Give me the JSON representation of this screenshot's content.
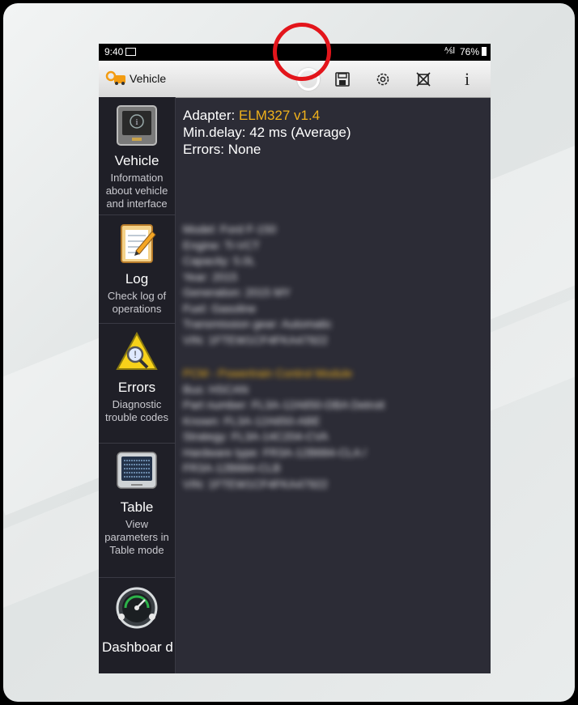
{
  "status_bar": {
    "time": "9:40",
    "signal": "⅍l",
    "battery": "76%"
  },
  "toolbar": {
    "title": "Vehicle",
    "info_label": "i"
  },
  "sidebar": {
    "items": [
      {
        "label": "Vehicle",
        "desc": "Information about vehicle and interface"
      },
      {
        "label": "Log",
        "desc": "Check log of operations"
      },
      {
        "label": "Errors",
        "desc": "Diagnostic trouble codes"
      },
      {
        "label": "Table",
        "desc": "View parameters in Table mode"
      },
      {
        "label": "Dashboar d",
        "desc": ""
      }
    ]
  },
  "main": {
    "adapter_label": "Adapter: ",
    "adapter_value": "ELM327 v1.4",
    "min_delay": "Min.delay: 42 ms (Average)",
    "errors": "Errors: None",
    "blurred_vehicle": [
      "Model: Ford F-150",
      "Engine: Ti-VCT",
      "Capacity: 5.0L",
      "Year: 2015",
      "Generation: 2015 MY",
      "Fuel: Gasoline",
      "Transmission gear: Automatic",
      "VIN: 1FTEW1CF4FKA47922"
    ],
    "blurred_module": [
      "PCM - Powertrain Control Module",
      "Bus: HSCAN",
      "Part number: FL3A-12A650-DBA Detroit",
      "Known: FL3A-12A650-ABE",
      "Strategy: FL3A-14C204-CVA",
      "Hardware type: FR3A-12B684-CLA /",
      "FR3A-12B684-CLB",
      "VIN: 1FTEW1CF4FKA47922"
    ]
  },
  "colors": {
    "accent": "#f1b21b",
    "highlight_circle": "#e3151b",
    "panel": "#2c2c36"
  }
}
